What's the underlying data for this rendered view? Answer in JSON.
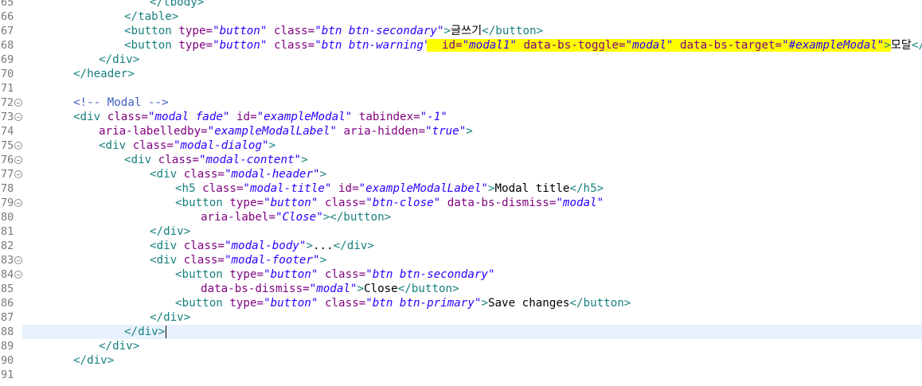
{
  "editor": {
    "lines": [
      {
        "num": "65",
        "indent": 5,
        "fold": false,
        "tokens": [
          {
            "t": "tag",
            "v": "</tbody>"
          }
        ]
      },
      {
        "num": "66",
        "indent": 4,
        "fold": false,
        "tokens": [
          {
            "t": "tag",
            "v": "</table>"
          }
        ]
      },
      {
        "num": "67",
        "indent": 4,
        "fold": false,
        "tokens": [
          {
            "t": "tag",
            "v": "<button "
          },
          {
            "t": "attr",
            "v": "type="
          },
          {
            "t": "val",
            "v": "\"button\""
          },
          {
            "t": "attr",
            "v": " class="
          },
          {
            "t": "val",
            "v": "\"btn btn-secondary\""
          },
          {
            "t": "tag",
            "v": ">"
          },
          {
            "t": "text",
            "v": "글쓰기"
          },
          {
            "t": "tag",
            "v": "</button>"
          }
        ]
      },
      {
        "num": "68",
        "indent": 4,
        "fold": false,
        "tokens": [
          {
            "t": "tag",
            "v": "<button "
          },
          {
            "t": "attr",
            "v": "type="
          },
          {
            "t": "val",
            "v": "\"button\""
          },
          {
            "t": "attr",
            "v": " class="
          },
          {
            "t": "val",
            "v": "\"btn btn-warning\""
          },
          {
            "t": "attr",
            "v": " id=",
            "hl": "start"
          },
          {
            "t": "val",
            "v": "\"modal1\"",
            "hl": true
          },
          {
            "t": "attr",
            "v": " data-bs-toggle=",
            "hl": true
          },
          {
            "t": "val",
            "v": "\"modal\"",
            "hl": true
          },
          {
            "t": "attr",
            "v": " data-bs-target=",
            "hl": true
          },
          {
            "t": "val",
            "v": "\"#exampleModal\"",
            "hl": true
          },
          {
            "t": "tag",
            "v": ">",
            "hl": true
          },
          {
            "t": "text",
            "v": "모달"
          },
          {
            "t": "tag",
            "v": "</button>"
          }
        ]
      },
      {
        "num": "69",
        "indent": 3,
        "fold": false,
        "tokens": [
          {
            "t": "tag",
            "v": "</div>"
          }
        ]
      },
      {
        "num": "70",
        "indent": 2,
        "fold": false,
        "tokens": [
          {
            "t": "tag",
            "v": "</header>"
          }
        ]
      },
      {
        "num": "71",
        "indent": 0,
        "fold": false,
        "tokens": []
      },
      {
        "num": "72",
        "indent": 2,
        "fold": true,
        "tokens": [
          {
            "t": "comment",
            "v": "<!-- Modal -->"
          }
        ]
      },
      {
        "num": "73",
        "indent": 2,
        "fold": true,
        "tokens": [
          {
            "t": "tag",
            "v": "<div "
          },
          {
            "t": "attr",
            "v": "class="
          },
          {
            "t": "val",
            "v": "\"modal fade\""
          },
          {
            "t": "attr",
            "v": " id="
          },
          {
            "t": "val",
            "v": "\"exampleModal\""
          },
          {
            "t": "attr",
            "v": " tabindex="
          },
          {
            "t": "val",
            "v": "\"-1\""
          }
        ]
      },
      {
        "num": "74",
        "indent": 3,
        "fold": false,
        "tokens": [
          {
            "t": "attr",
            "v": "aria-labelledby="
          },
          {
            "t": "val",
            "v": "\"exampleModalLabel\""
          },
          {
            "t": "attr",
            "v": " aria-hidden="
          },
          {
            "t": "val",
            "v": "\"true\""
          },
          {
            "t": "tag",
            "v": ">"
          }
        ]
      },
      {
        "num": "75",
        "indent": 3,
        "fold": true,
        "tokens": [
          {
            "t": "tag",
            "v": "<div "
          },
          {
            "t": "attr",
            "v": "class="
          },
          {
            "t": "val",
            "v": "\"modal-dialog\""
          },
          {
            "t": "tag",
            "v": ">"
          }
        ]
      },
      {
        "num": "76",
        "indent": 4,
        "fold": true,
        "tokens": [
          {
            "t": "tag",
            "v": "<div "
          },
          {
            "t": "attr",
            "v": "class="
          },
          {
            "t": "val",
            "v": "\"modal-content\""
          },
          {
            "t": "tag",
            "v": ">"
          }
        ]
      },
      {
        "num": "77",
        "indent": 5,
        "fold": true,
        "tokens": [
          {
            "t": "tag",
            "v": "<div "
          },
          {
            "t": "attr",
            "v": "class="
          },
          {
            "t": "val",
            "v": "\"modal-header\""
          },
          {
            "t": "tag",
            "v": ">"
          }
        ]
      },
      {
        "num": "78",
        "indent": 6,
        "fold": false,
        "tokens": [
          {
            "t": "tag",
            "v": "<h5 "
          },
          {
            "t": "attr",
            "v": "class="
          },
          {
            "t": "val",
            "v": "\"modal-title\""
          },
          {
            "t": "attr",
            "v": " id="
          },
          {
            "t": "val",
            "v": "\"exampleModalLabel\""
          },
          {
            "t": "tag",
            "v": ">"
          },
          {
            "t": "text",
            "v": "Modal title"
          },
          {
            "t": "tag",
            "v": "</h5>"
          }
        ]
      },
      {
        "num": "79",
        "indent": 6,
        "fold": true,
        "tokens": [
          {
            "t": "tag",
            "v": "<button "
          },
          {
            "t": "attr",
            "v": "type="
          },
          {
            "t": "val",
            "v": "\"button\""
          },
          {
            "t": "attr",
            "v": " class="
          },
          {
            "t": "val",
            "v": "\"btn-close\""
          },
          {
            "t": "attr",
            "v": " data-bs-dismiss="
          },
          {
            "t": "val",
            "v": "\"modal\""
          }
        ]
      },
      {
        "num": "80",
        "indent": 7,
        "fold": false,
        "tokens": [
          {
            "t": "attr",
            "v": "aria-label="
          },
          {
            "t": "val",
            "v": "\"Close\""
          },
          {
            "t": "tag",
            "v": "></button>"
          }
        ]
      },
      {
        "num": "81",
        "indent": 5,
        "fold": false,
        "tokens": [
          {
            "t": "tag",
            "v": "</div>"
          }
        ]
      },
      {
        "num": "82",
        "indent": 5,
        "fold": false,
        "tokens": [
          {
            "t": "tag",
            "v": "<div "
          },
          {
            "t": "attr",
            "v": "class="
          },
          {
            "t": "val",
            "v": "\"modal-body\""
          },
          {
            "t": "tag",
            "v": ">"
          },
          {
            "t": "text",
            "v": "..."
          },
          {
            "t": "tag",
            "v": "</div>"
          }
        ]
      },
      {
        "num": "83",
        "indent": 5,
        "fold": true,
        "tokens": [
          {
            "t": "tag",
            "v": "<div "
          },
          {
            "t": "attr",
            "v": "class="
          },
          {
            "t": "val",
            "v": "\"modal-footer\""
          },
          {
            "t": "tag",
            "v": ">"
          }
        ]
      },
      {
        "num": "84",
        "indent": 6,
        "fold": true,
        "tokens": [
          {
            "t": "tag",
            "v": "<button "
          },
          {
            "t": "attr",
            "v": "type="
          },
          {
            "t": "val",
            "v": "\"button\""
          },
          {
            "t": "attr",
            "v": " class="
          },
          {
            "t": "val",
            "v": "\"btn btn-secondary\""
          }
        ]
      },
      {
        "num": "85",
        "indent": 7,
        "fold": false,
        "tokens": [
          {
            "t": "attr",
            "v": "data-bs-dismiss="
          },
          {
            "t": "val",
            "v": "\"modal\""
          },
          {
            "t": "tag",
            "v": ">"
          },
          {
            "t": "text",
            "v": "Close"
          },
          {
            "t": "tag",
            "v": "</button>"
          }
        ]
      },
      {
        "num": "86",
        "indent": 6,
        "fold": false,
        "tokens": [
          {
            "t": "tag",
            "v": "<button "
          },
          {
            "t": "attr",
            "v": "type="
          },
          {
            "t": "val",
            "v": "\"button\""
          },
          {
            "t": "attr",
            "v": " class="
          },
          {
            "t": "val",
            "v": "\"btn btn-primary\""
          },
          {
            "t": "tag",
            "v": ">"
          },
          {
            "t": "text",
            "v": "Save changes"
          },
          {
            "t": "tag",
            "v": "</button>"
          }
        ]
      },
      {
        "num": "87",
        "indent": 5,
        "fold": false,
        "tokens": [
          {
            "t": "tag",
            "v": "</div>"
          }
        ]
      },
      {
        "num": "88",
        "indent": 4,
        "fold": false,
        "current": true,
        "caret": true,
        "tokens": [
          {
            "t": "tag",
            "v": "</div>"
          }
        ]
      },
      {
        "num": "89",
        "indent": 3,
        "fold": false,
        "tokens": [
          {
            "t": "tag",
            "v": "</div>"
          }
        ]
      },
      {
        "num": "90",
        "indent": 2,
        "fold": false,
        "tokens": [
          {
            "t": "tag",
            "v": "</div>"
          }
        ]
      },
      {
        "num": "91",
        "indent": 0,
        "fold": false,
        "tokens": []
      }
    ],
    "colors": {
      "tag": "#17807e",
      "attribute": "#7f007f",
      "value": "#2a00ff",
      "comment": "#3f5fbf",
      "highlight": "#ffff00",
      "current_line": "#e8f2fe"
    }
  }
}
